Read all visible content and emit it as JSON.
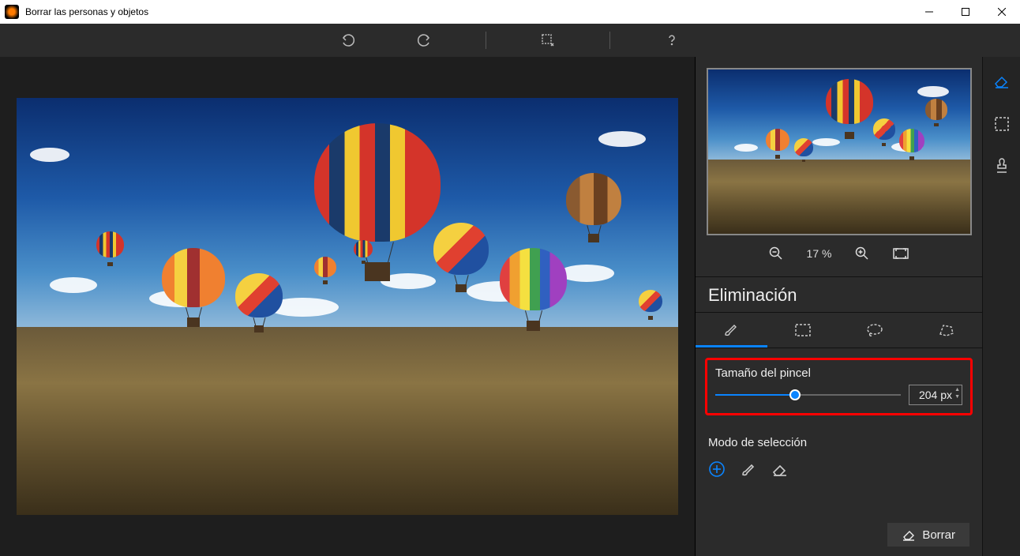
{
  "window": {
    "title": "Borrar las personas y objetos"
  },
  "zoom": {
    "level": "17 %"
  },
  "section": {
    "title": "Eliminación"
  },
  "brush": {
    "label": "Tamaño del pincel",
    "value": "204 px"
  },
  "mode": {
    "title": "Modo de selección"
  },
  "actions": {
    "erase": "Borrar"
  }
}
